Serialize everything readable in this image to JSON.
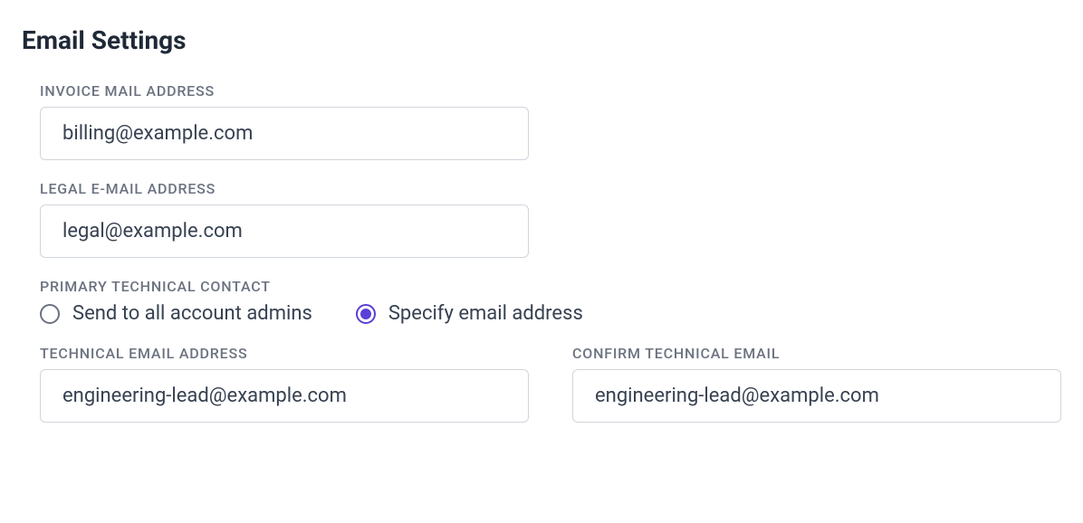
{
  "section": {
    "title": "Email Settings"
  },
  "invoice": {
    "label": "INVOICE MAIL ADDRESS",
    "value": "billing@example.com"
  },
  "legal": {
    "label": "LEGAL E-MAIL ADDRESS",
    "value": "legal@example.com"
  },
  "primaryContact": {
    "label": "PRIMARY TECHNICAL CONTACT",
    "options": {
      "all_admins": "Send to all account admins",
      "specify": "Specify email address"
    },
    "selected": "specify"
  },
  "technical": {
    "label": "TECHNICAL EMAIL ADDRESS",
    "value": "engineering-lead@example.com"
  },
  "confirmTechnical": {
    "label": "CONFIRM TECHNICAL EMAIL",
    "value": "engineering-lead@example.com"
  }
}
